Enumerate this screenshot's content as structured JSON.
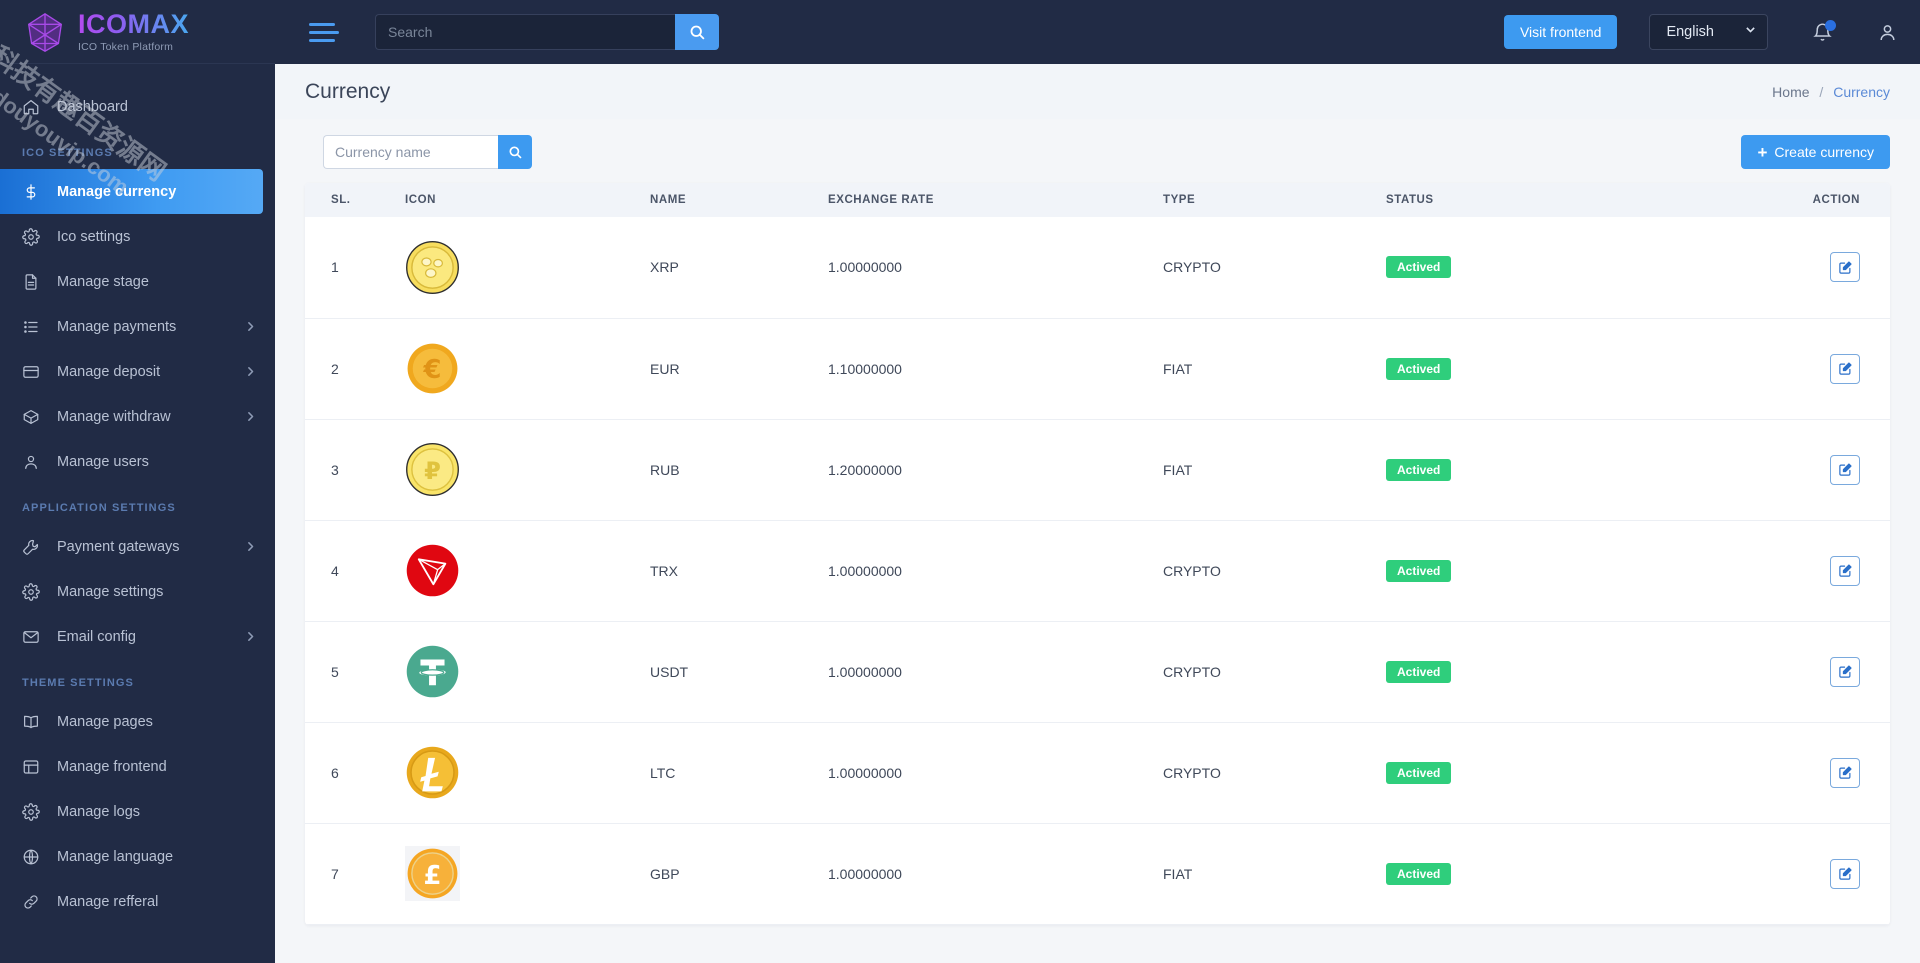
{
  "brand": {
    "name": "ICOMAX",
    "tagline": "ICO Token Platform"
  },
  "watermark": {
    "line1": "科技有趣百资源网",
    "line2": "douyouvip.com"
  },
  "topbar": {
    "search_placeholder": "Search",
    "search_value": "",
    "visit_frontend": "Visit frontend",
    "language": "English",
    "icons": {
      "menu": "hamburger-icon",
      "search": "search-icon",
      "bell": "bell-icon",
      "user": "user-icon",
      "chevron": "chevron-down-icon"
    }
  },
  "sidebar": {
    "top_items": [
      {
        "label": "Dashboard",
        "icon": "home-icon",
        "active": false,
        "caret": false
      }
    ],
    "sections": [
      {
        "title": "ICO SETTINGS",
        "items": [
          {
            "label": "Manage currency",
            "icon": "dollar-icon",
            "active": true,
            "caret": false
          },
          {
            "label": "Ico settings",
            "icon": "gear-icon",
            "active": false,
            "caret": false
          },
          {
            "label": "Manage stage",
            "icon": "file-icon",
            "active": false,
            "caret": false
          },
          {
            "label": "Manage payments",
            "icon": "list-icon",
            "active": false,
            "caret": true
          },
          {
            "label": "Manage deposit",
            "icon": "card-icon",
            "active": false,
            "caret": true
          },
          {
            "label": "Manage withdraw",
            "icon": "box-icon",
            "active": false,
            "caret": true
          },
          {
            "label": "Manage users",
            "icon": "user-icon",
            "active": false,
            "caret": false
          }
        ]
      },
      {
        "title": "APPLICATION SETTINGS",
        "items": [
          {
            "label": "Payment gateways",
            "icon": "wrench-icon",
            "active": false,
            "caret": true
          },
          {
            "label": "Manage settings",
            "icon": "gear-icon",
            "active": false,
            "caret": false
          },
          {
            "label": "Email config",
            "icon": "envelope-icon",
            "active": false,
            "caret": true
          }
        ]
      },
      {
        "title": "THEME SETTINGS",
        "items": [
          {
            "label": "Manage pages",
            "icon": "book-icon",
            "active": false,
            "caret": false
          },
          {
            "label": "Manage frontend",
            "icon": "layout-icon",
            "active": false,
            "caret": false
          },
          {
            "label": "Manage logs",
            "icon": "gear-icon",
            "active": false,
            "caret": false
          },
          {
            "label": "Manage language",
            "icon": "globe-icon",
            "active": false,
            "caret": false
          },
          {
            "label": "Manage refferal",
            "icon": "link-icon",
            "active": false,
            "caret": false
          }
        ]
      }
    ]
  },
  "page": {
    "title": "Currency",
    "breadcrumb": {
      "home": "Home",
      "separator": "/",
      "current": "Currency"
    }
  },
  "toolbar": {
    "filter_placeholder": "Currency name",
    "filter_value": "",
    "search_icon": "search-icon",
    "create_label": "Create currency",
    "create_plus": "+"
  },
  "table": {
    "columns": [
      "SL.",
      "ICON",
      "NAME",
      "EXCHANGE RATE",
      "TYPE",
      "STATUS",
      "ACTION"
    ],
    "action_icon": "edit-icon",
    "rows": [
      {
        "sl": "1",
        "icon": "xrp-coin-icon",
        "name": "XRP",
        "rate": "1.00000000",
        "type": "CRYPTO",
        "status": "Actived"
      },
      {
        "sl": "2",
        "icon": "eur-coin-icon",
        "name": "EUR",
        "rate": "1.10000000",
        "type": "FIAT",
        "status": "Actived"
      },
      {
        "sl": "3",
        "icon": "rub-coin-icon",
        "name": "RUB",
        "rate": "1.20000000",
        "type": "FIAT",
        "status": "Actived"
      },
      {
        "sl": "4",
        "icon": "trx-coin-icon",
        "name": "TRX",
        "rate": "1.00000000",
        "type": "CRYPTO",
        "status": "Actived"
      },
      {
        "sl": "5",
        "icon": "usdt-coin-icon",
        "name": "USDT",
        "rate": "1.00000000",
        "type": "CRYPTO",
        "status": "Actived"
      },
      {
        "sl": "6",
        "icon": "ltc-coin-icon",
        "name": "LTC",
        "rate": "1.00000000",
        "type": "CRYPTO",
        "status": "Actived"
      },
      {
        "sl": "7",
        "icon": "gbp-coin-icon",
        "name": "GBP",
        "rate": "1.00000000",
        "type": "FIAT",
        "status": "Actived"
      }
    ]
  },
  "colors": {
    "sidebar_bg": "#212b45",
    "accent_blue": "#3d9af0",
    "status_green": "#2fce7c",
    "page_bg": "#f4f6f9"
  }
}
